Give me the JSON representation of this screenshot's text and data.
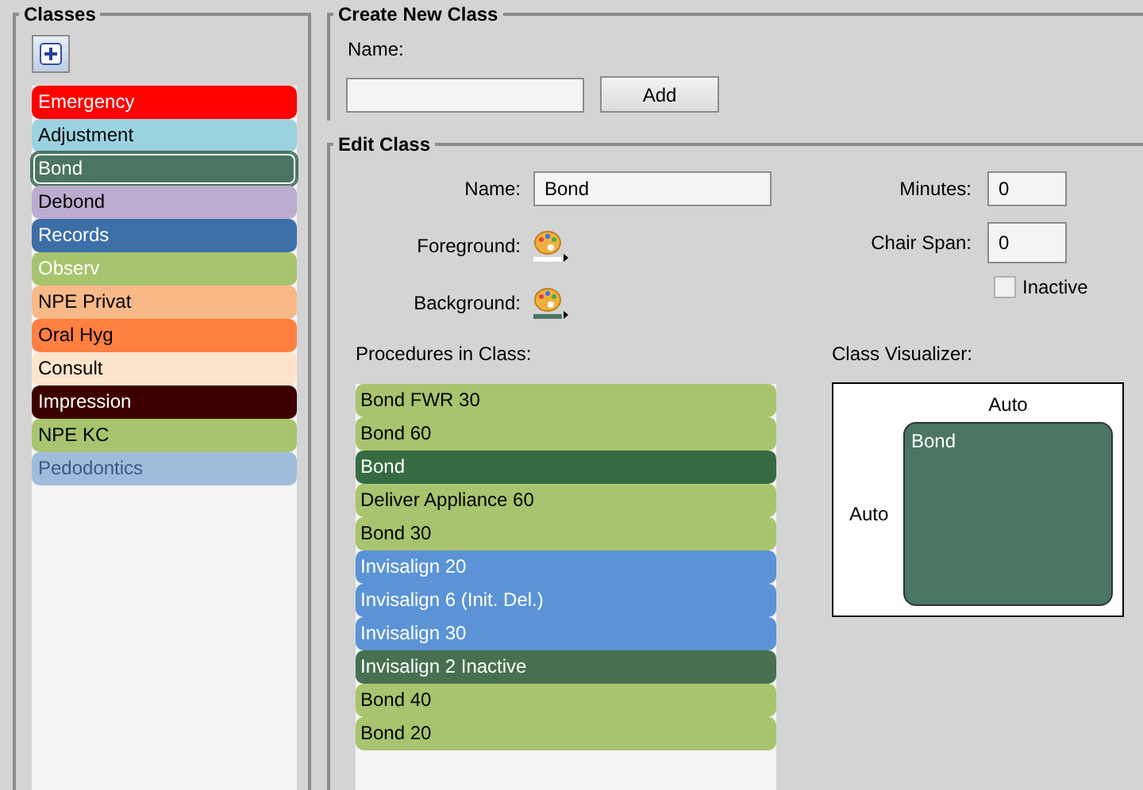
{
  "classes_panel": {
    "title": "Classes",
    "items": [
      {
        "label": "Emergency",
        "color": "#ff0000",
        "kind": "light",
        "selected": false
      },
      {
        "label": "Adjustment",
        "color": "#9ad3df",
        "kind": "dark",
        "selected": false
      },
      {
        "label": "Bond",
        "color": "#4a7563",
        "kind": "light",
        "selected": true
      },
      {
        "label": "Debond",
        "color": "#bcaccf",
        "kind": "dark",
        "selected": false
      },
      {
        "label": "Records",
        "color": "#3c6ea8",
        "kind": "light",
        "selected": false
      },
      {
        "label": "Observ",
        "color": "#a8c46e",
        "kind": "light",
        "selected": false
      },
      {
        "label": "NPE Privat",
        "color": "#f8b988",
        "kind": "dark",
        "selected": false
      },
      {
        "label": "Oral Hyg",
        "color": "#ff8040",
        "kind": "dark",
        "selected": false
      },
      {
        "label": "Consult",
        "color": "#fde4cc",
        "kind": "dark",
        "selected": false
      },
      {
        "label": "Impression",
        "color": "#3d0000",
        "kind": "light",
        "selected": false
      },
      {
        "label": "NPE KC",
        "color": "#a8c46e",
        "kind": "dark",
        "selected": false
      },
      {
        "label": "Pedodontics",
        "color": "#a0bcdd",
        "kind": "muted",
        "selected": false
      }
    ]
  },
  "create_class": {
    "title": "Create New Class",
    "name_label": "Name:",
    "add_button": "Add"
  },
  "edit_class": {
    "title": "Edit Class",
    "name_label": "Name:",
    "name_value": "Bond",
    "minutes_label": "Minutes:",
    "minutes_value": "0",
    "chair_span_label": "Chair Span:",
    "chair_span_value": "0",
    "foreground": {
      "label": "Foreground:",
      "color": "#ffffff"
    },
    "background": {
      "label": "Background:",
      "color": "#4a7563"
    },
    "inactive": {
      "label": "Inactive",
      "checked": false
    },
    "procedures_label": "Procedures in Class:",
    "procedures": [
      {
        "label": "Bond FWR 30",
        "color": "#a8c46e",
        "kind": "dark"
      },
      {
        "label": "Bond 60",
        "color": "#a8c46e",
        "kind": "dark"
      },
      {
        "label": "Bond",
        "color": "#366b42",
        "kind": "light"
      },
      {
        "label": "Deliver Appliance 60",
        "color": "#a8c46e",
        "kind": "dark"
      },
      {
        "label": "Bond 30",
        "color": "#a8c46e",
        "kind": "dark"
      },
      {
        "label": "Invisalign 20",
        "color": "#5b93d6",
        "kind": "light"
      },
      {
        "label": "Invisalign 6 (Init. Del.)",
        "color": "#5b93d6",
        "kind": "light"
      },
      {
        "label": "Invisalign 30",
        "color": "#5b93d6",
        "kind": "light"
      },
      {
        "label": "Invisalign 2 Inactive",
        "color": "#46704f",
        "kind": "light"
      },
      {
        "label": "Bond 40",
        "color": "#a8c46e",
        "kind": "dark"
      },
      {
        "label": "Bond 20",
        "color": "#a8c46e",
        "kind": "dark"
      }
    ],
    "visualizer": {
      "label": "Class Visualizer:",
      "top_label": "Auto",
      "side_label": "Auto",
      "block_label": "Bond"
    }
  }
}
